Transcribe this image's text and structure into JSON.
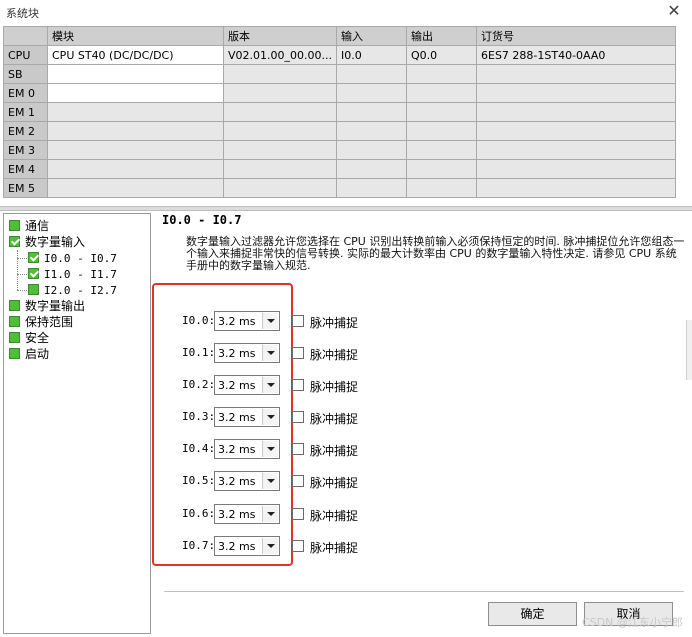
{
  "window": {
    "title": "系统块"
  },
  "grid": {
    "headers": [
      "",
      "模块",
      "版本",
      "输入",
      "输出",
      "订货号"
    ],
    "rows": [
      {
        "slot": "CPU",
        "module": "CPU ST40 (DC/DC/DC)",
        "version": "V02.01.00_00.00...",
        "input": "I0.0",
        "output": "Q0.0",
        "order": "6ES7 288-1ST40-0AA0"
      },
      {
        "slot": "SB",
        "module": "",
        "version": "",
        "input": "",
        "output": "",
        "order": ""
      },
      {
        "slot": "EM 0",
        "module": "",
        "version": "",
        "input": "",
        "output": "",
        "order": ""
      },
      {
        "slot": "EM 1",
        "module": "",
        "version": "",
        "input": "",
        "output": "",
        "order": ""
      },
      {
        "slot": "EM 2",
        "module": "",
        "version": "",
        "input": "",
        "output": "",
        "order": ""
      },
      {
        "slot": "EM 3",
        "module": "",
        "version": "",
        "input": "",
        "output": "",
        "order": ""
      },
      {
        "slot": "EM 4",
        "module": "",
        "version": "",
        "input": "",
        "output": "",
        "order": ""
      },
      {
        "slot": "EM 5",
        "module": "",
        "version": "",
        "input": "",
        "output": "",
        "order": ""
      }
    ]
  },
  "tree": {
    "items": [
      {
        "label": "通信",
        "checked": false
      },
      {
        "label": "数字量输入",
        "checked": true
      },
      {
        "label": "I0.0 - I0.7",
        "checked": true
      },
      {
        "label": "I1.0 - I1.7",
        "checked": true
      },
      {
        "label": "I2.0 - I2.7",
        "checked": false
      },
      {
        "label": "数字量输出",
        "checked": false
      },
      {
        "label": "保持范围",
        "checked": false
      },
      {
        "label": "安全",
        "checked": false
      },
      {
        "label": "启动",
        "checked": false
      }
    ]
  },
  "panel": {
    "title": "I0.0 - I0.7",
    "description": "数字量输入过滤器允许您选择在 CPU 识别出转换前输入必须保持恒定的时间. 脉冲捕捉位允许您组态一个输入来捕捉非常快的信号转换. 实际的最大计数率由 CPU 的数字量输入特性决定. 请参见 CPU 系统手册中的数字量输入规范.",
    "pulse_label": "脉冲捕捉",
    "inputs": [
      {
        "label": "I0.0:",
        "filter": "3.2 ms",
        "pulse_catch": false
      },
      {
        "label": "I0.1:",
        "filter": "3.2 ms",
        "pulse_catch": false
      },
      {
        "label": "I0.2:",
        "filter": "3.2 ms",
        "pulse_catch": false
      },
      {
        "label": "I0.3:",
        "filter": "3.2 ms",
        "pulse_catch": false
      },
      {
        "label": "I0.4:",
        "filter": "3.2 ms",
        "pulse_catch": false
      },
      {
        "label": "I0.5:",
        "filter": "3.2 ms",
        "pulse_catch": false
      },
      {
        "label": "I0.6:",
        "filter": "3.2 ms",
        "pulse_catch": false
      },
      {
        "label": "I0.7:",
        "filter": "3.2 ms",
        "pulse_catch": false
      }
    ],
    "highlight_color": "#e8302a"
  },
  "buttons": {
    "ok": "确定",
    "cancel": "取消"
  },
  "watermark": "CSDN @江东小宁郎",
  "colors": {
    "check_green": "#4fbf3a",
    "grid_header": "#cfcfcf",
    "grid_cell": "#e7e7e7"
  }
}
